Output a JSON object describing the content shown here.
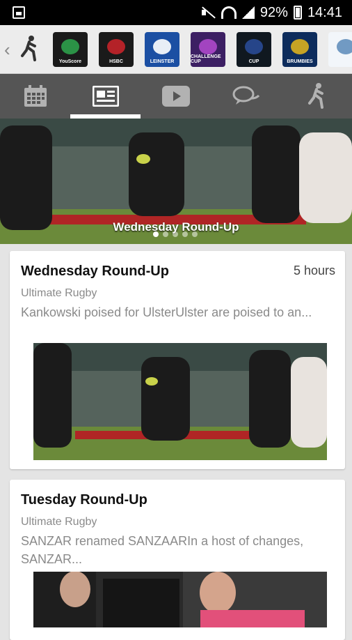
{
  "status_bar": {
    "battery": "92%",
    "time": "14:41",
    "icons": [
      "gallery-icon",
      "mute-icon",
      "wifi-icon",
      "signal-icon",
      "battery-icon"
    ]
  },
  "logo_strip": {
    "logos": [
      {
        "name": "youscore",
        "label": "YouScore",
        "color": "#1a1a1a"
      },
      {
        "name": "hsbc-sevens",
        "label": "HSBC",
        "color": "#1a1a1a"
      },
      {
        "name": "leinster",
        "label": "LEINSTER",
        "color": "#1b4fa3"
      },
      {
        "name": "challenge-cup",
        "label": "CHALLENGE CUP",
        "color": "#3c1f63"
      },
      {
        "name": "champions-cup",
        "label": "CUP",
        "color": "#101820"
      },
      {
        "name": "brumbies",
        "label": "BRUMBIES",
        "color": "#0d2c5c"
      },
      {
        "name": "partial-logo",
        "label": "",
        "color": "#f2f6fa"
      }
    ]
  },
  "tabs": [
    {
      "name": "calendar",
      "active": false
    },
    {
      "name": "news",
      "active": true
    },
    {
      "name": "video",
      "active": false
    },
    {
      "name": "chat",
      "active": false
    },
    {
      "name": "player",
      "active": false
    }
  ],
  "hero": {
    "title": "Wednesday Round-Up",
    "dots": 5,
    "active_dot": 0
  },
  "articles": [
    {
      "title": "Wednesday Round-Up",
      "time": "5 hours",
      "source": "Ultimate Rugby",
      "excerpt": "Kankowski poised for UlsterUlster are poised to an..."
    },
    {
      "title": "Tuesday Round-Up",
      "time": "",
      "source": "Ultimate Rugby",
      "excerpt": "SANZAR renamed SANZAARIn a host of changes, SANZAR..."
    }
  ],
  "colors": {
    "tabbar": "#555555",
    "background": "#e4e4e4",
    "accent": "#ffffff"
  }
}
